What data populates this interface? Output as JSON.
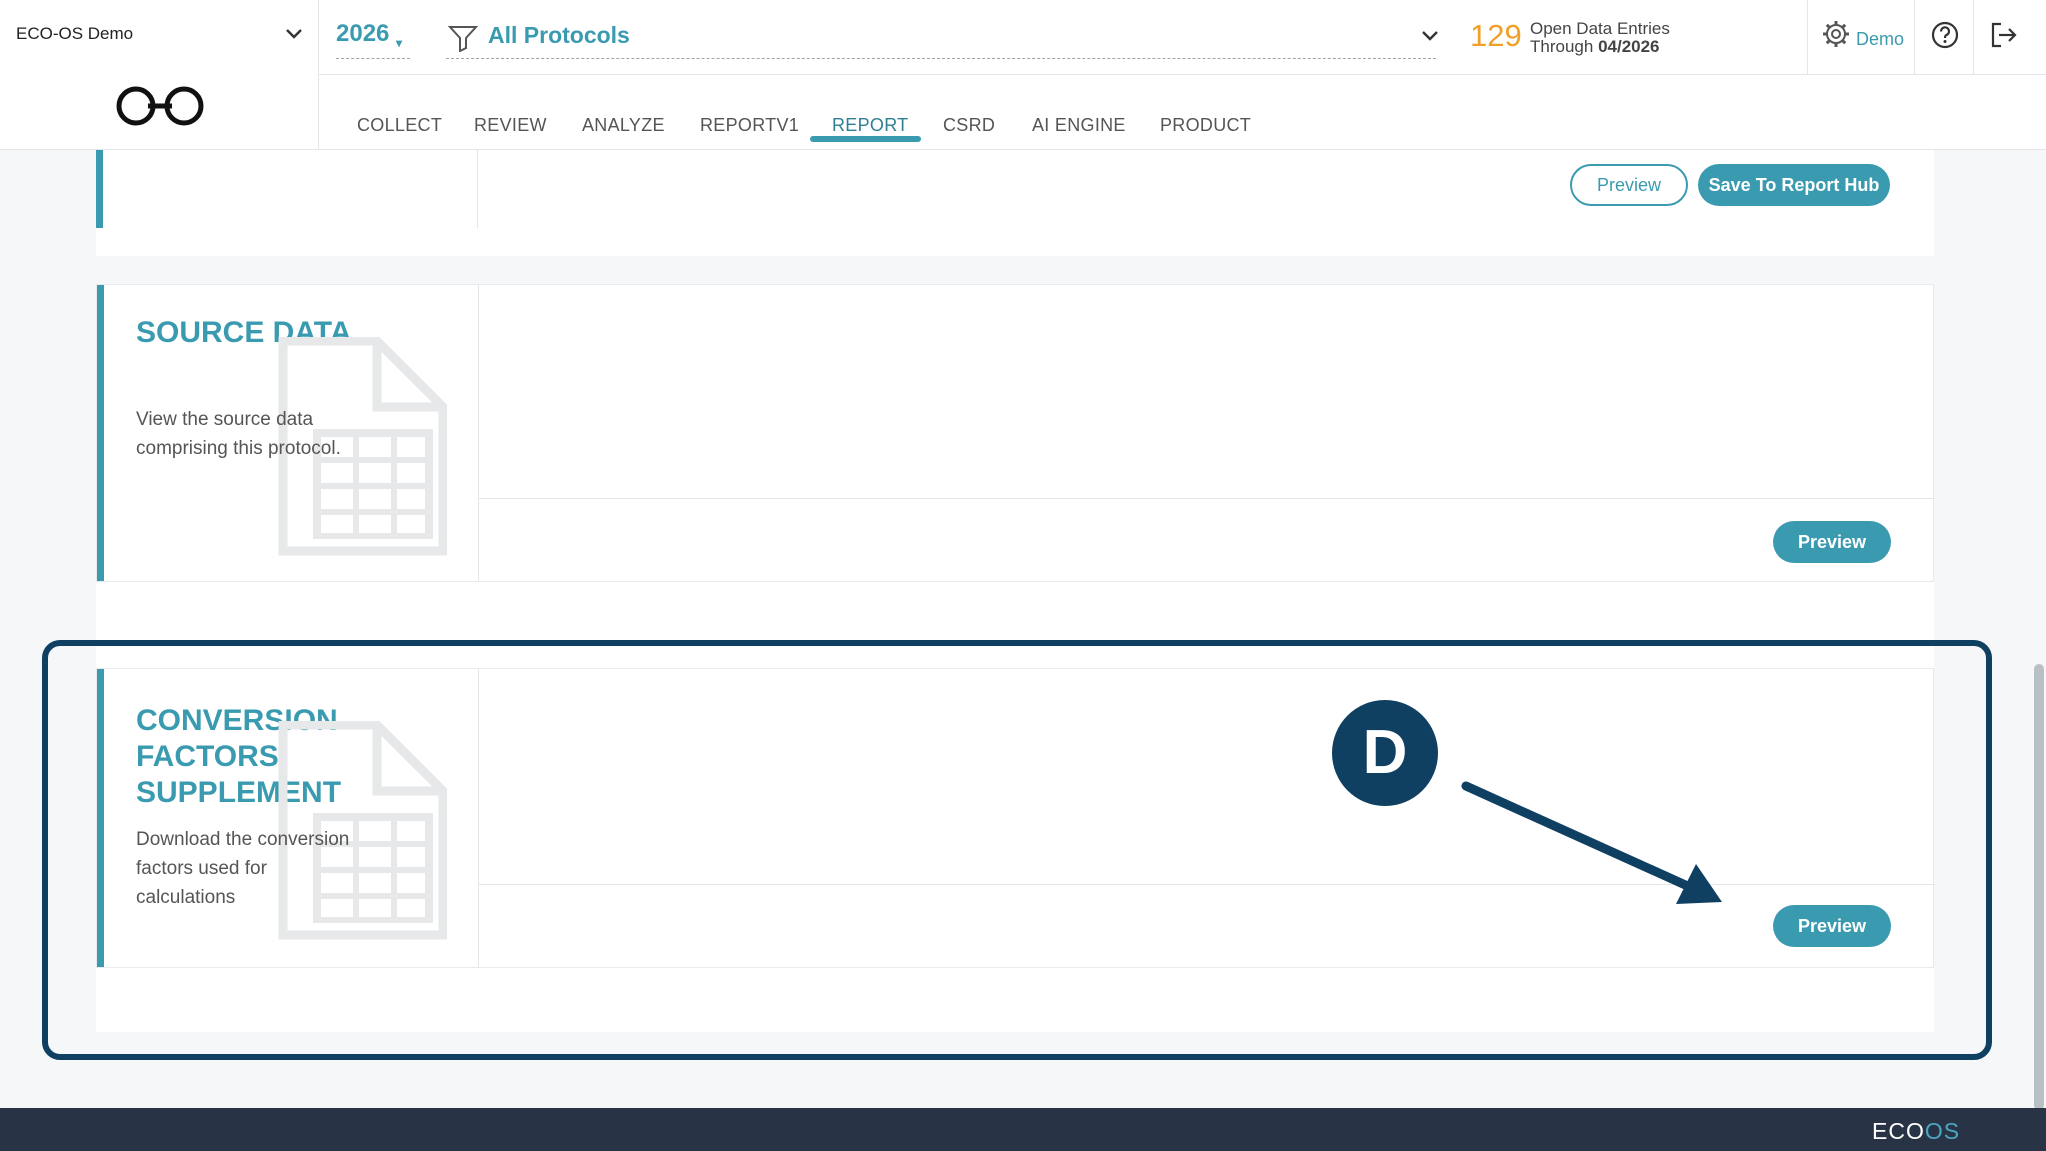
{
  "header": {
    "org_name": "ECO-OS Demo",
    "year": "2026",
    "protocol": "All Protocols",
    "open_count": "129",
    "open_label": "Open Data Entries",
    "open_through_prefix": "Through",
    "open_through_date": "04/2026",
    "user_label": "Demo"
  },
  "tabs": [
    {
      "label": "COLLECT"
    },
    {
      "label": "REVIEW"
    },
    {
      "label": "ANALYZE"
    },
    {
      "label": "REPORTV1"
    },
    {
      "label": "REPORT",
      "active": true
    },
    {
      "label": "CSRD"
    },
    {
      "label": "AI ENGINE"
    },
    {
      "label": "PRODUCT"
    }
  ],
  "top_card": {
    "preview_label": "Preview",
    "save_label": "Save To Report Hub"
  },
  "source_card": {
    "title": "SOURCE DATA",
    "description": "View the source data comprising this protocol.",
    "preview_label": "Preview"
  },
  "conversion_card": {
    "title": "CONVERSION FACTORS SUPPLEMENT",
    "description": "Download the conversion factors used for calculations",
    "preview_label": "Preview"
  },
  "annotation": {
    "badge": "D"
  },
  "footer": {
    "logo_a": "ECO",
    "logo_b": "OS"
  },
  "colors": {
    "accent": "#3a9bb0",
    "count": "#f0a027",
    "highlight": "#0f3f61",
    "footer": "#283445"
  }
}
